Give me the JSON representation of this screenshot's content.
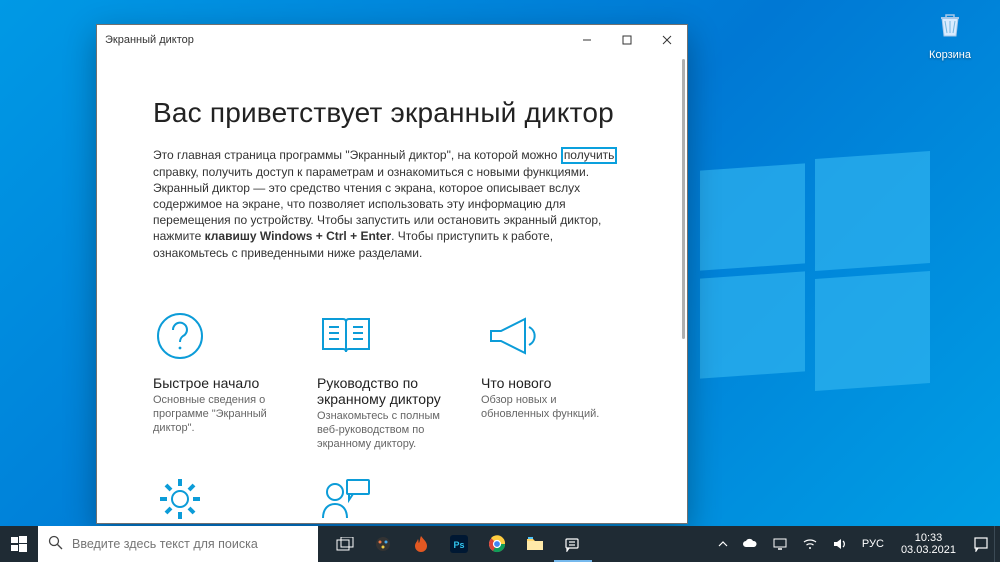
{
  "desktop": {
    "recycle_bin_label": "Корзина"
  },
  "window": {
    "title": "Экранный диктор",
    "heading": "Вас приветствует экранный диктор",
    "intro_p1a": "Это главная страница программы \"Экранный диктор\", на которой можно ",
    "intro_hl": "получить",
    "intro_p1b": " справку, получить доступ к параметрам и ознакомиться с новыми функциями. Экранный диктор — это средство чтения с экрана, которое описывает вслух содержимое на экране, что позволяет использовать эту информацию для перемещения по устройству. Чтобы запустить или остановить экранный диктор, нажмите ",
    "intro_bold": "клавишу Windows + Ctrl + Enter",
    "intro_p1c": ". Чтобы приступить к работе, ознакомьтесь с приведенными ниже разделами.",
    "cards": [
      {
        "title": "Быстрое начало",
        "desc": "Основные сведения о программе \"Экранный диктор\"."
      },
      {
        "title": "Руководство по экранному диктору",
        "desc": "Ознакомьтесь с полным веб-руководством по экранному диктору."
      },
      {
        "title": "Что нового",
        "desc": "Обзор новых и обновленных функций."
      }
    ]
  },
  "taskbar": {
    "search_placeholder": "Введите здесь текст для поиска",
    "lang": "РУС",
    "time": "10:33",
    "date": "03.03.2021"
  }
}
